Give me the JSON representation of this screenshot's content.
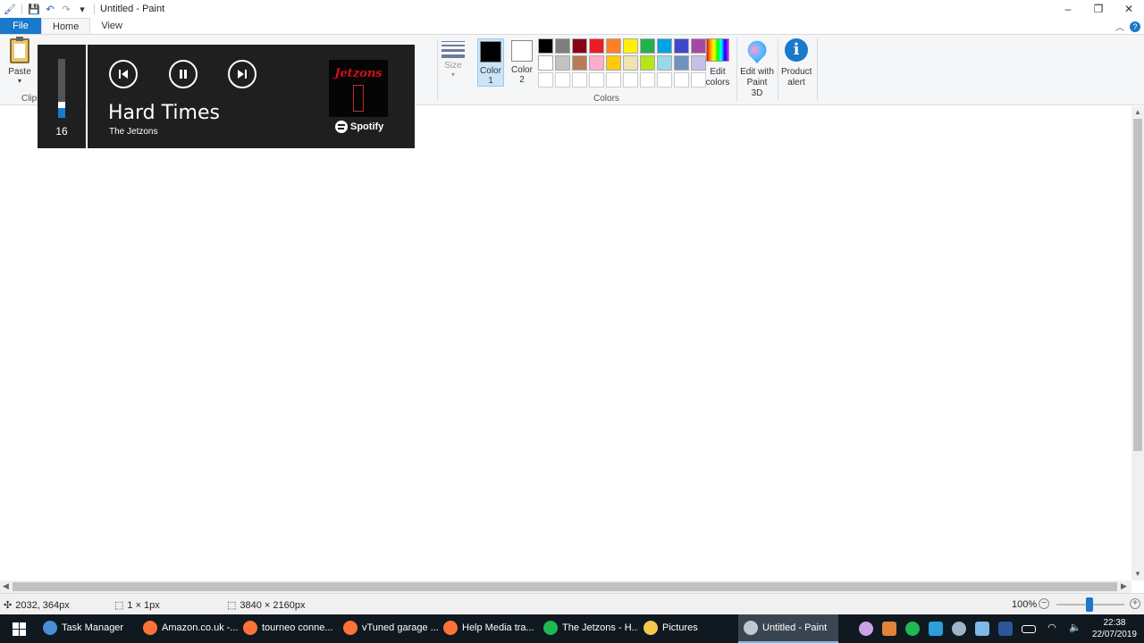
{
  "window": {
    "title": "Untitled - Paint",
    "controls": [
      "–",
      "❐",
      "✕"
    ]
  },
  "quick_access": [
    "save-icon",
    "undo-icon",
    "redo-icon",
    "customize-icon"
  ],
  "tabs": {
    "file": "File",
    "home": "Home",
    "view": "View"
  },
  "ribbon": {
    "paste_label": "Paste",
    "clipboard_group": "Clipb",
    "size_label": "Size",
    "color1_label": "Color",
    "color1_num": "1",
    "color2_label": "Color",
    "color2_num": "2",
    "colors_group": "Colors",
    "edit_colors_line1": "Edit",
    "edit_colors_line2": "colors",
    "paint3d_line1": "Edit with",
    "paint3d_line2": "Paint 3D",
    "product_alert_line1": "Product",
    "product_alert_line2": "alert",
    "color1_value": "#000000",
    "color2_value": "#ffffff",
    "palette": [
      "#000000",
      "#7f7f7f",
      "#880015",
      "#ed1c24",
      "#ff7f27",
      "#fff200",
      "#22b14c",
      "#00a2e8",
      "#3f48cc",
      "#a349a4",
      "#ffffff",
      "#c3c3c3",
      "#b97a57",
      "#ffaec9",
      "#ffc90e",
      "#efe4b0",
      "#b5e61d",
      "#99d9ea",
      "#7092be",
      "#c8bfe7"
    ]
  },
  "status": {
    "cursor_pos": "2032, 364px",
    "selection_size": "1 × 1px",
    "image_size": "3840 × 2160px",
    "zoom": "100%",
    "zoom_level_percent": 100
  },
  "media_overlay": {
    "volume": "16",
    "volume_level": 0.16,
    "track_title": "Hard Times",
    "artist": "The Jetzons",
    "album_logo": "Jetzons",
    "app_name": "Spotify"
  },
  "taskbar": {
    "items": [
      {
        "label": "Task Manager",
        "icon": "task-manager-icon",
        "color": "#4a8fd6"
      },
      {
        "label": "Amazon.co.uk -...",
        "icon": "firefox-icon",
        "color": "#ff7139"
      },
      {
        "label": "tourneo conne...",
        "icon": "firefox-icon",
        "color": "#ff7139"
      },
      {
        "label": "vTuned garage ...",
        "icon": "firefox-icon",
        "color": "#ff7139"
      },
      {
        "label": "Help Media tra...",
        "icon": "firefox-icon",
        "color": "#ff7139"
      },
      {
        "label": "The Jetzons - H...",
        "icon": "spotify-icon",
        "color": "#1db954"
      },
      {
        "label": "Pictures",
        "icon": "folder-icon",
        "color": "#f2c94c"
      },
      {
        "label": "Untitled - Paint",
        "icon": "paint-icon",
        "color": "#c0c8d0"
      }
    ],
    "clock_time": "22:38",
    "clock_date": "22/07/2019"
  }
}
